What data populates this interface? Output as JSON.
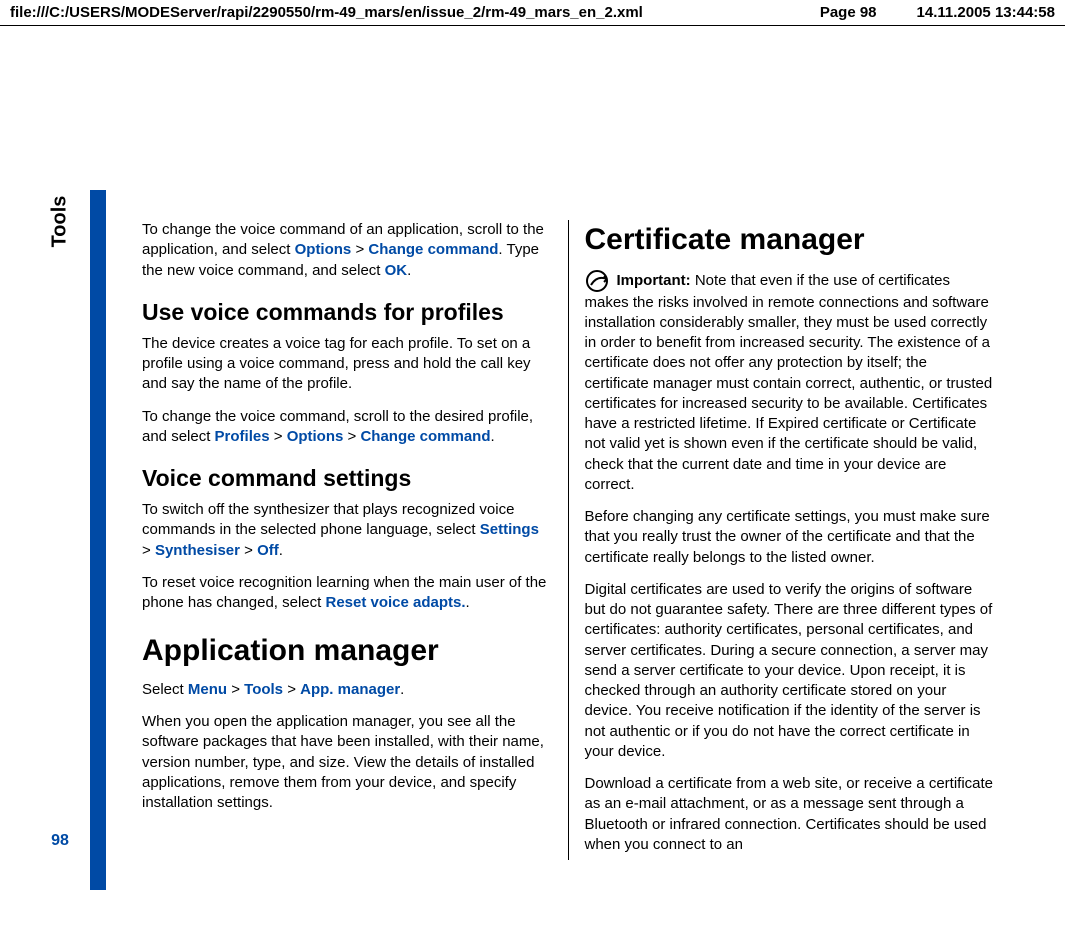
{
  "header": {
    "path": "file:///C:/USERS/MODEServer/rapi/2290550/rm-49_mars/en/issue_2/rm-49_mars_en_2.xml",
    "page": "Page 98",
    "datetime": "14.11.2005 13:44:58"
  },
  "sidebar": {
    "section_label": "Tools",
    "page_number": "98"
  },
  "left": {
    "p1_a": "To change the voice command of an application, scroll to the application, and select ",
    "p1_link1": "Options",
    "p1_gt1": " > ",
    "p1_link2": "Change command",
    "p1_b": ". Type the new voice command, and select ",
    "p1_link3": "OK",
    "p1_c": ".",
    "h1": "Use voice commands for profiles",
    "p2": "The device creates a voice tag for each profile. To set on a profile using a voice command, press and hold the call key and say the name of the profile.",
    "p3_a": "To change the voice command, scroll to the desired profile, and select ",
    "p3_link1": "Profiles",
    "p3_gt1": " > ",
    "p3_link2": "Options",
    "p3_gt2": " > ",
    "p3_link3": "Change command",
    "p3_b": ".",
    "h2": "Voice command settings",
    "p4_a": "To switch off the synthesizer that plays recognized voice commands in the selected phone language, select ",
    "p4_link1": "Settings",
    "p4_gt1": " > ",
    "p4_link2": "Synthesiser",
    "p4_gt2": " > ",
    "p4_link3": "Off",
    "p4_b": ".",
    "p5_a": "To reset voice recognition learning when the main user of the phone has changed, select ",
    "p5_link1": "Reset voice adapts.",
    "p5_b": ".",
    "h3": "Application manager",
    "p6_a": "Select ",
    "p6_link1": "Menu",
    "p6_gt1": " > ",
    "p6_link2": "Tools",
    "p6_gt2": " > ",
    "p6_link3": "App. manager",
    "p6_b": ".",
    "p7": "When you open the application manager, you see all the software packages that have been installed, with their name, version number, type, and size. View the details of installed applications, remove them from your device, and specify installation settings."
  },
  "right": {
    "h1": "Certificate manager",
    "important_label": "Important:",
    "p1": "  Note that even if the use of certificates makes the risks involved in remote connections and software installation considerably smaller, they must be used correctly in order to benefit from increased security. The existence of a certificate does not offer any protection by itself; the certificate manager must contain correct, authentic, or trusted certificates for increased security to be available. Certificates have a restricted lifetime. If Expired certificate or Certificate not valid yet is shown even if the certificate should be valid, check that the current date and time in your device are correct.",
    "p2": "Before changing any certificate settings, you must make sure that you really trust the owner of the certificate and that the certificate really belongs to the listed owner.",
    "p3": "Digital certificates are used to verify the origins of software but do not guarantee safety. There are three different types of certificates: authority certificates, personal certificates, and server certificates. During a secure connection, a server may send a server certificate to your device. Upon receipt, it is checked through an authority certificate stored on your device. You receive notification if the identity of the server is not authentic or if you do not have the correct certificate in your device.",
    "p4": "Download a certificate from a web site, or receive a certificate as an e-mail attachment, or as a message sent through a Bluetooth or infrared connection. Certificates should be used when you connect to an"
  }
}
